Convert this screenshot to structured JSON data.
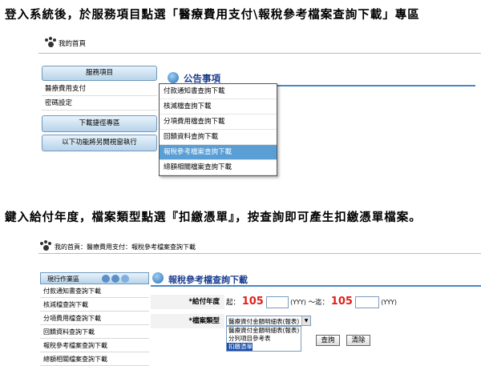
{
  "instructions": {
    "step1": "登入系統後，於服務項目點選「醫療費用支付\\報稅參考檔案查詢下載」專區",
    "step2": "鍵入給付年度，檔案類型點選『扣繳憑單』，按查詢即可產生扣繳憑單檔案。"
  },
  "shot1": {
    "home_label": "我的首頁",
    "sidebar": {
      "service_button": "服務項目",
      "items": [
        "醫療費用支付",
        "密碼設定"
      ],
      "download_button": "下載捷徑專區",
      "function_button": "以下功能將另開視窗執行"
    },
    "announcement_title": "公告事項",
    "dropdown_items": [
      "付款通知書查詢下載",
      "核減檔查詢下載",
      "分項費用檔查詢下載",
      "回饋資料查詢下載",
      "報稅參考檔案查詢下載",
      "總額相關檔案查詢下載"
    ],
    "dropdown_selected_index": 4
  },
  "shot2": {
    "breadcrumb": "我的首頁：醫療費用支付：報稅參考檔案查詢下載",
    "sidebar_title": "現行作業區",
    "sidebar_items": [
      "付款通知書查詢下載",
      "核減檔查詢下載",
      "分項費用檔查詢下載",
      "回饋資料查詢下載",
      "報稅參考檔案查詢下載",
      "總額相關檔案查詢下載"
    ],
    "page_title": "報稅參考檔查詢下載",
    "year_label": "*給付年度",
    "year_from_prefix": "起：",
    "year_from": "105",
    "year_unit_1": "(YYY)",
    "year_to_prefix": "～迄：",
    "year_to": "105",
    "year_unit_2": "(YYY)",
    "file_type_label": "*檔案類型",
    "file_type_selected": "醫療資付金額明細表(報表)",
    "file_type_options": [
      "醫療資付金額明細表(報表)",
      "分列項目參考表",
      "扣繳憑單"
    ],
    "file_type_highlight_index": 2,
    "query_button": "查詢",
    "clear_button": "清除"
  },
  "colors": {
    "accent_blue": "#1a3d8f",
    "header_bar": "#4a86c5",
    "highlight": "#5a9ed6",
    "year_red": "#e0201b"
  }
}
